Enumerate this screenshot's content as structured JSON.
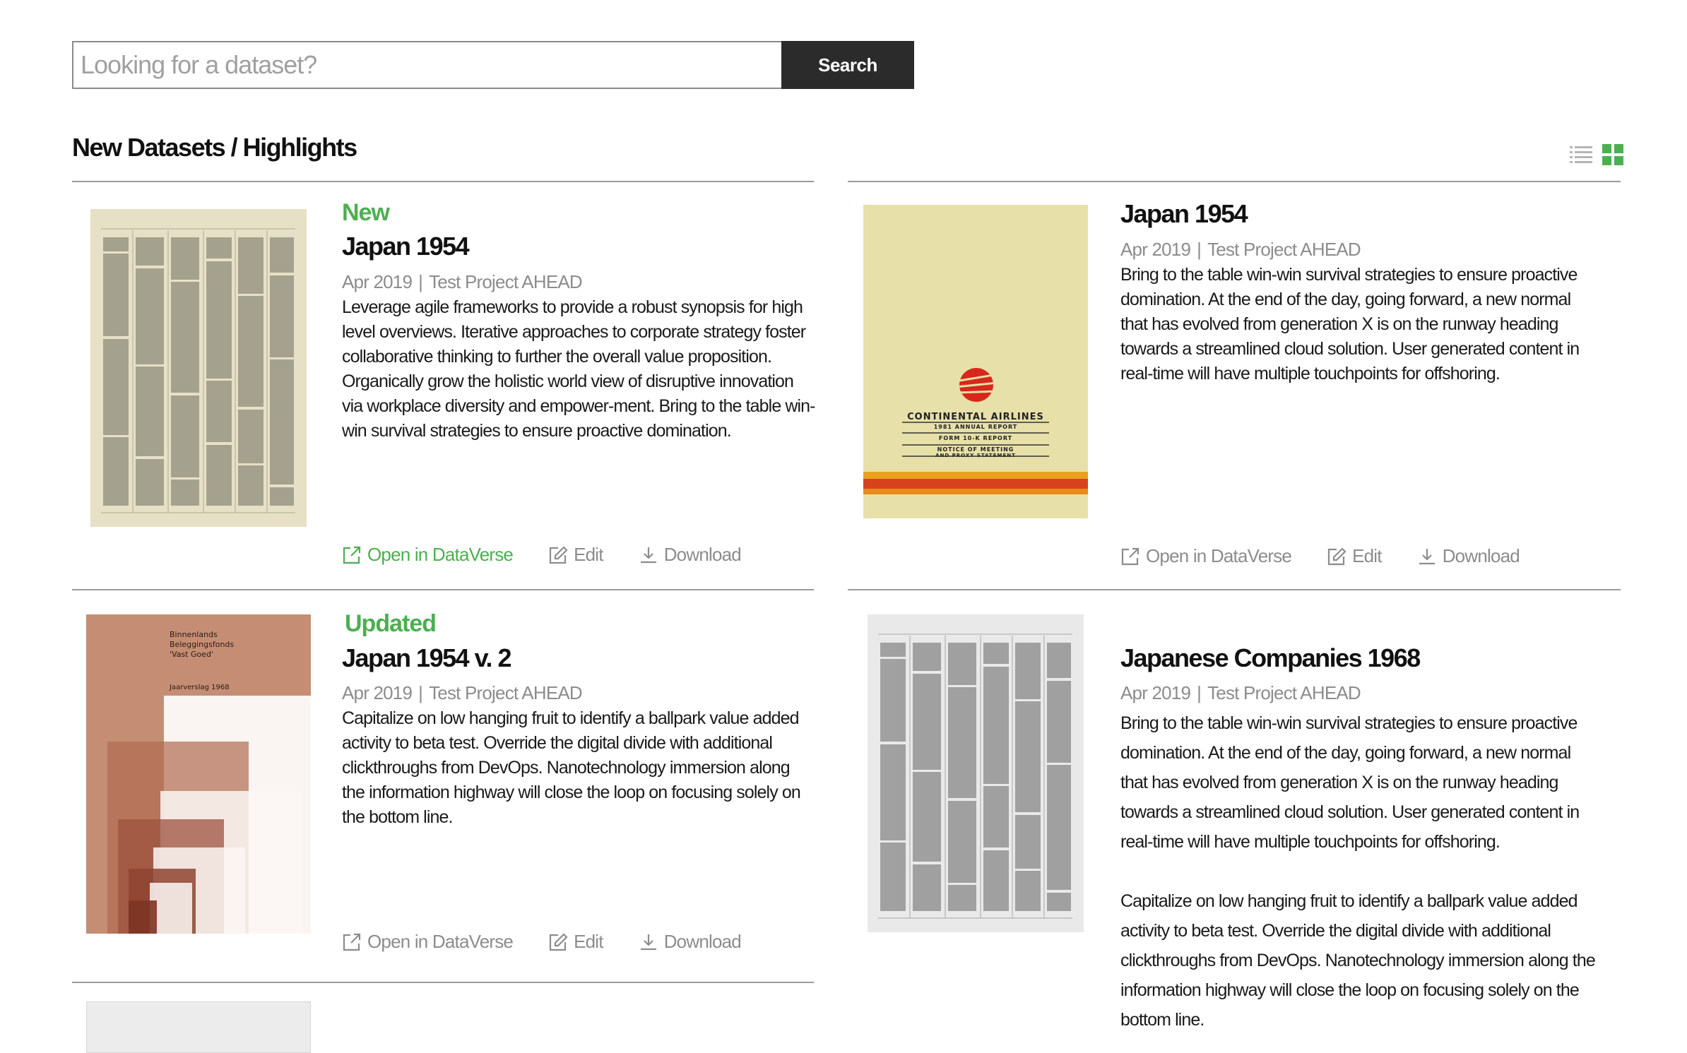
{
  "search": {
    "placeholder": "Looking for a dataset?",
    "button_label": "Search"
  },
  "section": {
    "title": "New Datasets / Highlights"
  },
  "view_toggle": {
    "icons": [
      "list-view-icon",
      "grid-view-icon"
    ],
    "active": "grid"
  },
  "colors": {
    "accent": "#4caf50",
    "button_bg": "#2b2b2b",
    "muted_text": "#8c8c8c",
    "divider": "#9a9a9a"
  },
  "actions": {
    "open": "Open in DataVerse",
    "edit": "Edit",
    "download": "Download"
  },
  "datasets": [
    {
      "status": "New",
      "title": "Japan 1954",
      "date": "Apr 2019",
      "project": "Test Project AHEAD",
      "description": "Leverage agile frameworks to provide a robust synopsis for high level overviews. Iterative approaches to corporate strategy foster collaborative thinking to further the overall value proposition. Organically grow the holistic world view of disruptive innovation via workplace diversity and empower-ment. Bring to the table win-win survival strategies to ensure proactive domination."
    },
    {
      "status": "",
      "title": "Japan 1954",
      "date": "Apr 2019",
      "project": "Test Project AHEAD",
      "description": "Bring to the table win-win survival strategies to ensure proactive domination. At the end of the day, going forward, a new normal that has evolved from generation X is on the runway heading towards a streamlined cloud solution. User generated content in real-time will have multiple touchpoints for offshoring.",
      "cover": {
        "airline": "CONTINENTAL AIRLINES",
        "line1": "1981 ANNUAL REPORT",
        "line2": "FORM 10-K REPORT",
        "line3": "NOTICE OF MEETING",
        "line4": "AND PROXY STATEMENT"
      }
    },
    {
      "status": "Updated",
      "title": "Japan 1954 v. 2",
      "date": "Apr 2019",
      "project": "Test Project AHEAD",
      "description": "Capitalize on low hanging fruit to identify a ballpark value added activity to beta test. Override the digital divide with additional clickthroughs from DevOps. Nanotechnology immersion along the information highway will close the loop on focusing solely on the bottom line.",
      "cover": {
        "line1": "Binnenlands",
        "line2": "Beleggingsfonds",
        "line3": "'Vast Goed'",
        "line4": "Jaarverslag 1968"
      }
    },
    {
      "status": "",
      "title": "Japanese Companies 1968",
      "date": "Apr 2019",
      "project": "Test Project AHEAD",
      "description": "Bring to the table win-win survival strategies to ensure proactive domination. At the end of the day, going forward, a new normal that has evolved from generation X is on the runway heading towards a streamlined cloud solution. User generated content in real-time will have multiple touchpoints for offshoring.",
      "description2": "Capitalize on low hanging fruit to identify a ballpark value added activity to beta test. Override the digital divide with additional clickthroughs from DevOps. Nanotechnology immersion along the information highway will close the loop on focusing solely on the bottom line."
    }
  ]
}
